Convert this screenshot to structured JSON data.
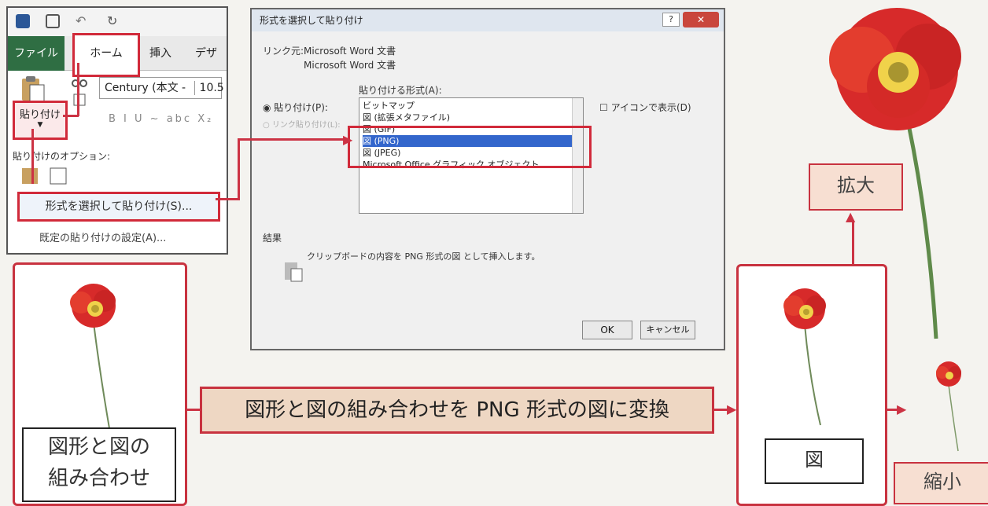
{
  "ribbon": {
    "tabs": {
      "file": "ファイル",
      "home": "ホーム",
      "insert": "挿入",
      "design": "デザ"
    },
    "font_name": "Century (本文 - ",
    "font_size": "10.5",
    "paste_label": "貼り付け",
    "format_row": "B  I  U ~ abc X₂",
    "paste_options_label": "貼り付けのオプション:",
    "paste_special": "形式を選択して貼り付け(S)...",
    "default_paste": "既定の貼り付けの設定(A)..."
  },
  "dialog": {
    "title": "形式を選択して貼り付け",
    "help": "?",
    "close": "✕",
    "link_label": "リンク元:",
    "source1": "Microsoft Word 文書",
    "source2": "Microsoft Word 文書",
    "paste_as_label": "貼り付ける形式(A):",
    "paste_radio": "貼り付け(P):",
    "link_radio": "リンク貼り付け(L):",
    "show_as_icon": "アイコンで表示(D)",
    "list_items": [
      "ビットマップ",
      "図 (拡張メタファイル)",
      "図 (GIF)",
      "図 (PNG)",
      "図 (JPEG)",
      "Microsoft Office グラフィック オブジェクト"
    ],
    "selected_item": "図 (PNG)",
    "result_label": "結果",
    "result_text": "クリップボードの内容を PNG 形式の図 として挿入します。",
    "ok": "OK",
    "cancel": "キャンセル"
  },
  "diagram": {
    "combo_line1": "図形と図の",
    "combo_line2": "組み合わせ",
    "convert_text": "図形と図の組み合わせを PNG 形式の図に変換",
    "figure_label": "図",
    "enlarge": "拡大",
    "shrink": "縮小"
  },
  "colors": {
    "accent_red": "#c8323f",
    "word_green": "#2f6e43",
    "selection_blue": "#3366cc",
    "banner_fill": "#eed7c3",
    "label_fill": "#f7dfd2"
  }
}
